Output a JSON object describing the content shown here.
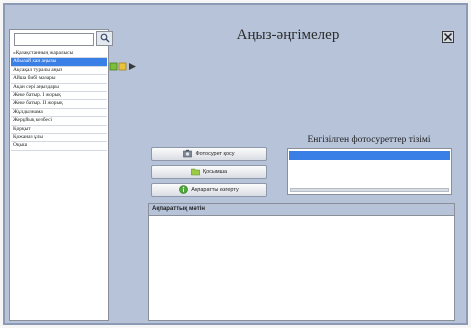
{
  "window": {
    "title": "Аңыз-әңгімелер"
  },
  "sidebar": {
    "search": {
      "value": "",
      "placeholder": ""
    },
    "items": [
      {
        "label": "«Қазақстанның жаралысы",
        "selected": false
      },
      {
        "label": "Абылай хан аңызы",
        "selected": true
      },
      {
        "label": "Ақсақал туралы аңыз",
        "selected": false
      },
      {
        "label": "Айша бибі мазары",
        "selected": false
      },
      {
        "label": "Ақан сері аңыздары",
        "selected": false
      },
      {
        "label": "Жеке батыр. І жорық",
        "selected": false
      },
      {
        "label": "Жеке батыр. ІІ жорық",
        "selected": false
      },
      {
        "label": "Жұлдызнама",
        "selected": false
      },
      {
        "label": "Жерұйық кезбесі",
        "selected": false
      },
      {
        "label": "Қорқыт",
        "selected": false
      },
      {
        "label": "Қожаназ ұлы",
        "selected": false
      },
      {
        "label": "Оқыш",
        "selected": false
      }
    ]
  },
  "actions": [
    {
      "label": "Фотосурет қосу",
      "icon": "photo-icon"
    },
    {
      "label": "Қосымша",
      "icon": "folder-icon"
    },
    {
      "label": "Ақпаратты өзгерту",
      "icon": "info-icon"
    }
  ],
  "photo_list": {
    "label": "Енгізілген фотосуреттер тізімі"
  },
  "info_panel": {
    "header": "Ақпараттық мәтін"
  },
  "colors": {
    "window_bg": "#b6c3d9",
    "selection": "#3a7fe6",
    "panel_bg": "#ffffff"
  }
}
